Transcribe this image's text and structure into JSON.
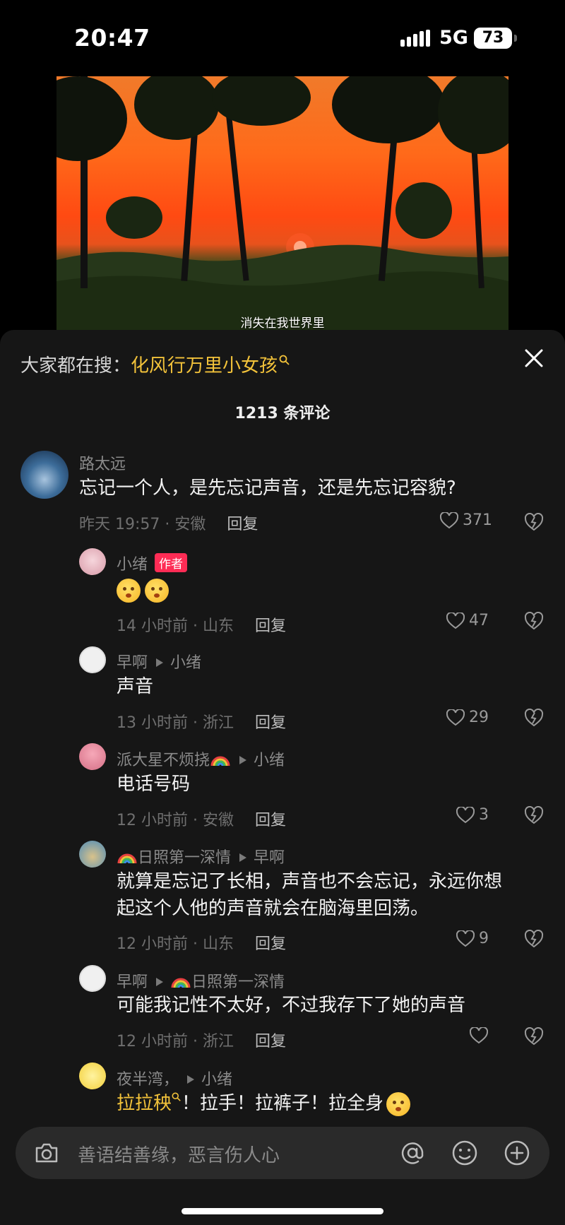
{
  "status": {
    "time": "20:47",
    "network": "5G",
    "battery": "73"
  },
  "video": {
    "caption": "消失在我世界里"
  },
  "header": {
    "search_label": "大家都在搜：",
    "search_keyword": "化风行万里小女孩"
  },
  "comment_count": "1213 条评论",
  "comments": [
    {
      "user": "路太远",
      "text": "忘记一个人，是先忘记声音，还是先忘记容貌?",
      "meta": "昨天 19:57 · 安徽",
      "reply": "回复",
      "likes": "371"
    },
    {
      "user": "小绪",
      "badge": "作者",
      "meta": "14 小时前 · 山东",
      "reply": "回复",
      "likes": "47"
    },
    {
      "user": "早啊",
      "target": "小绪",
      "text": "声音",
      "meta": "13 小时前 · 浙江",
      "reply": "回复",
      "likes": "29"
    },
    {
      "user": "派大星不烦挠",
      "target": "小绪",
      "text": "电话号码",
      "meta": "12 小时前 · 安徽",
      "reply": "回复",
      "likes": "3"
    },
    {
      "user": "日照第一深情",
      "target": "早啊",
      "text_line1": "就算是忘记了长相，声音也不会忘记，永远你想",
      "text_line2": "起这个人他的声音就会在脑海里回荡。",
      "meta": "12 小时前 · 山东",
      "reply": "回复",
      "likes": "9"
    },
    {
      "user": "早啊",
      "target": "日照第一深情",
      "text": "可能我记性不太好，不过我存下了她的声音",
      "meta": "12 小时前 · 浙江",
      "reply": "回复",
      "likes": ""
    },
    {
      "user": "夜半湾，",
      "target": "小绪",
      "link": "拉拉秧",
      "text": "！拉手！拉裤子！拉全身"
    }
  ],
  "input": {
    "placeholder": "善语结善缘，恶言伤人心"
  }
}
